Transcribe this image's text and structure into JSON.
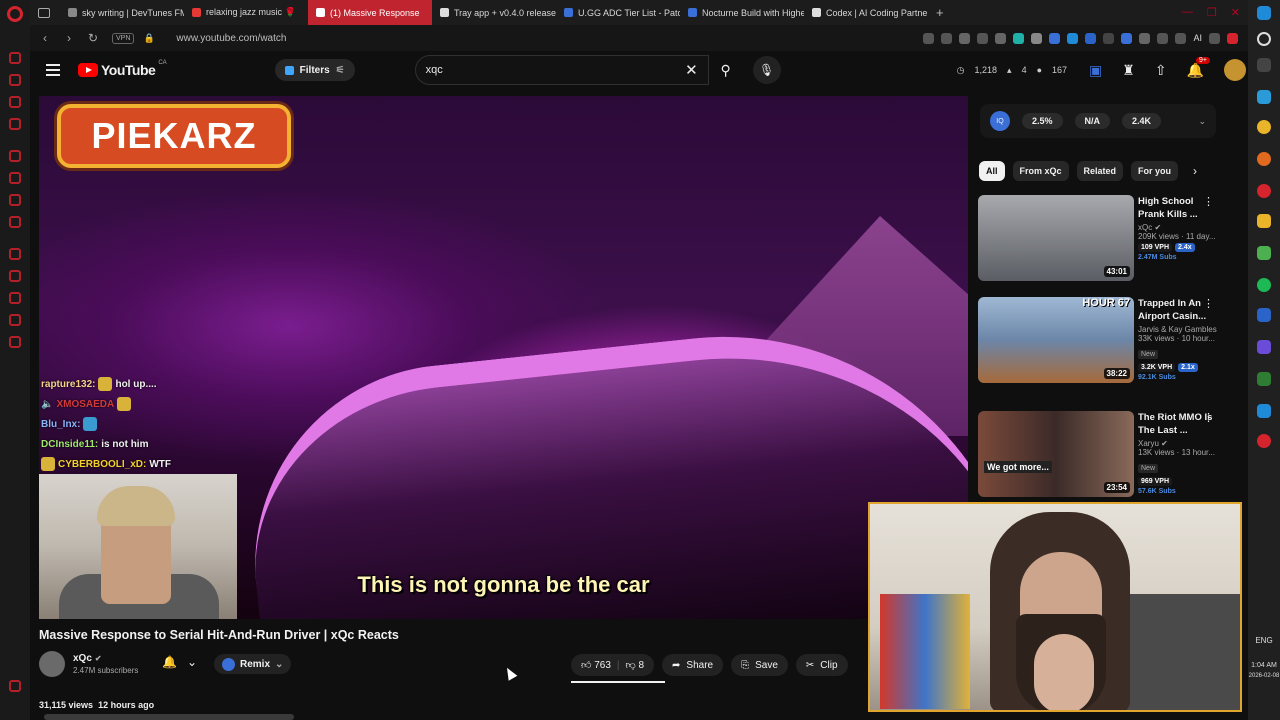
{
  "browser": {
    "tabs": [
      {
        "label": "sky writing | DevTunes FM",
        "color": "#888888",
        "active": false
      },
      {
        "label": "relaxing jazz music 🌹",
        "color": "#e53935",
        "active": false
      },
      {
        "label": "(1) Massive Response",
        "color": "#ffffff",
        "active": true
      },
      {
        "label": "Tray app + v0.4.0 release",
        "color": "#dddddd",
        "active": false
      },
      {
        "label": "U.GG ADC Tier List - Patch",
        "color": "#3b6fd8",
        "active": false
      },
      {
        "label": "Nocturne Build with Highe",
        "color": "#3b6fd8",
        "active": false
      },
      {
        "label": "Codex | AI Coding Partner",
        "color": "#dddddd",
        "active": false
      }
    ],
    "new_tab": "+",
    "vpn": "VPN",
    "url": "www.youtube.com/watch",
    "ai_label": "AI"
  },
  "header": {
    "logo_word": "YouTube",
    "logo_region": "CA",
    "filters_label": "Filters",
    "search_value": "xqc",
    "stats": {
      "views": "1,218",
      "likes": "4",
      "other": "167"
    },
    "notif_count": "9+"
  },
  "player": {
    "streamer_logo": "PIEKARZ",
    "chat": [
      {
        "user": "rapture132:",
        "msg": "hol up...."
      },
      {
        "user": "",
        "msg": "XMOSAEDA"
      },
      {
        "user": "Blu_Inx:",
        "msg": ""
      },
      {
        "user": "DCInside11:",
        "msg": "is not him"
      },
      {
        "user": "CYBERBOOLI_xD:",
        "msg": "WTF"
      }
    ],
    "subtitle": "This is not gonna be the car"
  },
  "video": {
    "title": "Massive Response to Serial Hit-And-Run Driver | xQc Reacts",
    "channel": "xQc",
    "subscribers": "2.47M subscribers",
    "remix_label": "Remix",
    "likes": "763",
    "dislikes": "8",
    "share_label": "Share",
    "save_label": "Save",
    "clip_label": "Clip",
    "views": "31,115 views",
    "age": "12 hours ago"
  },
  "extension": {
    "badge": "IQ",
    "stat1": "2.5%",
    "stat2": "N/A",
    "stat3": "2.4K"
  },
  "chips": [
    "All",
    "From xQc",
    "Related",
    "For you"
  ],
  "recommendations": [
    {
      "title": "High School Prank Kills ...",
      "channel": "xQc",
      "views": "209K views · 11 day...",
      "duration": "43:01",
      "new": "",
      "vph": "109 VPH",
      "mult": "2.4x",
      "subs": "2.47M Subs",
      "thumb": "#8a8f96"
    },
    {
      "title": "Trapped In An Airport Casin...",
      "channel": "Jarvis & Kay Gambles",
      "views": "33K views · 10 hour...",
      "duration": "38:22",
      "new": "New",
      "vph": "3.2K VPH",
      "mult": "2.1x",
      "subs": "92.1K Subs",
      "thumb": "#6c86a8"
    },
    {
      "title": "The Riot MMO Is The Last ...",
      "channel": "Xaryu",
      "views": "13K views · 13 hour...",
      "duration": "23:54",
      "new": "New",
      "vph": "969 VPH",
      "mult": "",
      "subs": "57.6K Subs",
      "thumb": "#5a3a30"
    }
  ],
  "rec_thumb_text": {
    "hour": "HOUR 67",
    "got_more": "We got more..."
  },
  "system": {
    "lang": "ENG",
    "time": "1:04 AM",
    "date": "2026-02-08"
  }
}
